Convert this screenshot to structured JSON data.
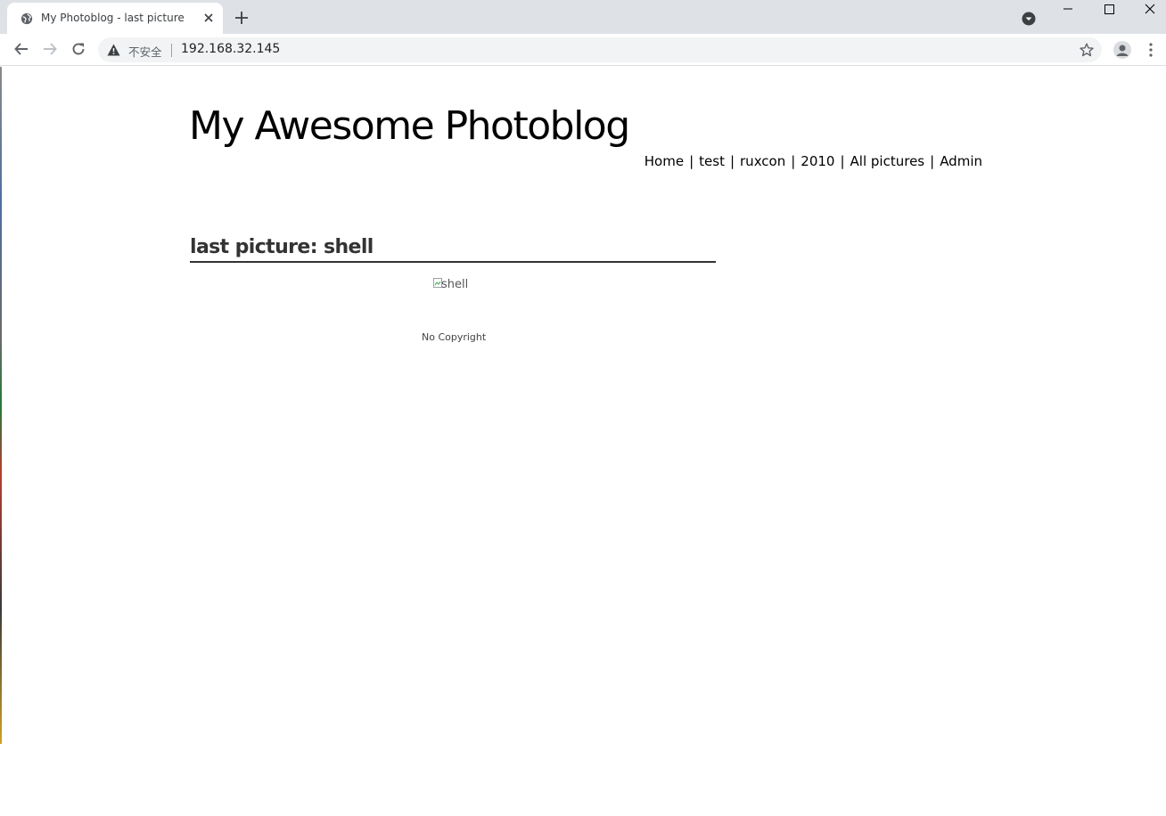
{
  "browser": {
    "tab": {
      "title": "My Photoblog - last picture",
      "favicon": "globe-icon"
    },
    "address_bar": {
      "security_label": "不安全",
      "url": "192.168.32.145"
    }
  },
  "page": {
    "site_title": "My Awesome Photoblog",
    "nav": [
      {
        "label": "Home"
      },
      {
        "label": "test"
      },
      {
        "label": "ruxcon"
      },
      {
        "label": "2010"
      },
      {
        "label": "All pictures"
      },
      {
        "label": "Admin"
      }
    ],
    "nav_separator": "|",
    "section_heading": "last picture: shell",
    "image_alt": "shell",
    "footer": "No Copyright"
  }
}
